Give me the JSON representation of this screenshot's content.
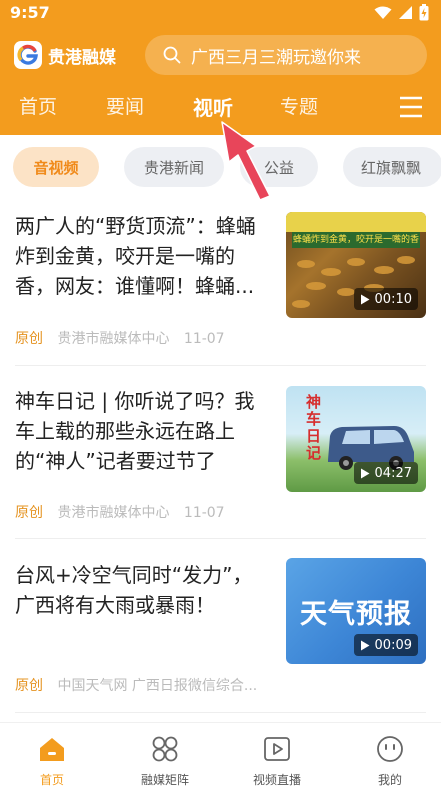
{
  "status": {
    "time": "9:57"
  },
  "app": {
    "name": "贵港融媒"
  },
  "search": {
    "placeholder": "广西三月三潮玩邀你来"
  },
  "nav": {
    "items": [
      "首页",
      "要闻",
      "视听",
      "专题"
    ],
    "active": "视听"
  },
  "subtabs": {
    "items": [
      "音视频",
      "贵港新闻",
      "公益",
      "红旗飘飘"
    ],
    "active": "音视频"
  },
  "articles": [
    {
      "title": "两广人的“野货顶流”：蜂蛹炸到金黄，咬开是一嘴的香，网友：谁懂啊！蜂蛹...",
      "tag": "原创",
      "source": "贵港市融媒体中心",
      "date": "11-07",
      "duration": "00:10",
      "thumb_caption": "蜂蛹炸到金黄，咬开是一嘴的香"
    },
    {
      "title": "神车日记 | 你听说了吗？我车上载的那些永远在路上的“神人”记者要过节了",
      "tag": "原创",
      "source": "贵港市融媒体中心",
      "date": "11-07",
      "duration": "04:27",
      "thumb_caption": "神车日记"
    },
    {
      "title": "台风+冷空气同时“发力”，广西将有大雨或暴雨！",
      "tag": "原创",
      "source": "中国天气网 广西日报微信综合...",
      "date": "",
      "duration": "00:09",
      "thumb_caption": "天气预报"
    }
  ],
  "tabbar": {
    "items": [
      "首页",
      "融媒矩阵",
      "视频直播",
      "我的"
    ],
    "active": "首页"
  },
  "colors": {
    "brand": "#F39C1E",
    "tag": "#E59423",
    "arrow": "#E8455A"
  }
}
